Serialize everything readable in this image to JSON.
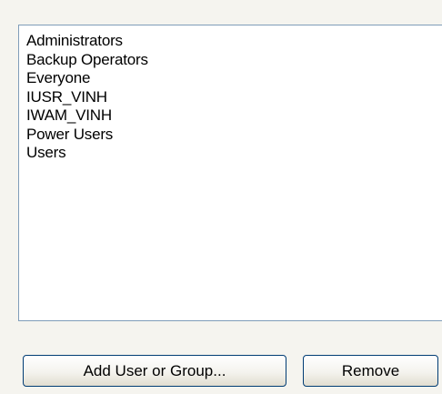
{
  "groups_list": {
    "items": [
      "Administrators",
      "Backup Operators",
      "Everyone",
      "IUSR_VINH",
      "IWAM_VINH",
      "Power Users",
      "Users"
    ]
  },
  "buttons": {
    "add_label": "Add User or Group...",
    "remove_label": "Remove"
  }
}
